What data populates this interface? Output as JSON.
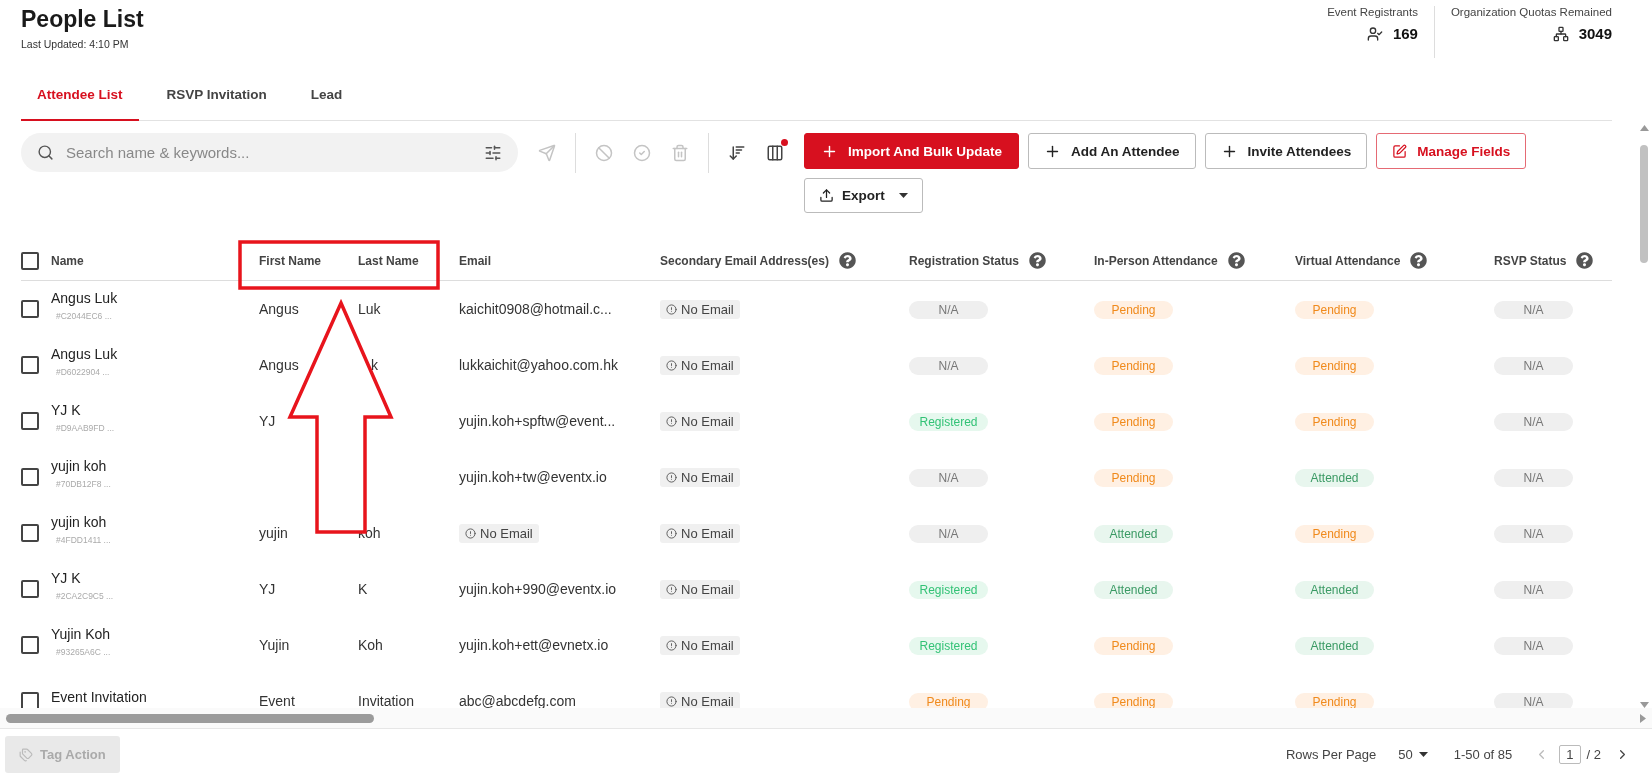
{
  "page": {
    "title": "People List",
    "subtitle": "Last Updated: 4:10 PM"
  },
  "stats": [
    {
      "label": "Event Registrants",
      "value": "169",
      "kind": "registrants"
    },
    {
      "label": "Organization Quotas Remained",
      "value": "3049",
      "kind": "quota"
    }
  ],
  "tabs": [
    {
      "label": "Attendee List",
      "selected": true
    },
    {
      "label": "RSVP Invitation",
      "selected": false
    },
    {
      "label": "Lead",
      "selected": false
    }
  ],
  "search": {
    "placeholder": "Search name & keywords..."
  },
  "toolbar": {
    "column_alert": true,
    "actions_disabled": true
  },
  "buttons": [
    {
      "label": "Import And Bulk Update",
      "kind": "primary"
    },
    {
      "label": "Add An Attendee",
      "kind": "add"
    },
    {
      "label": "Invite Attendees",
      "kind": "add"
    },
    {
      "label": "Manage Fields",
      "kind": "danger"
    },
    {
      "label": "Export",
      "kind": "export"
    }
  ],
  "table": {
    "select_all": false,
    "columns": [
      {
        "label": "Name",
        "help": false
      },
      {
        "label": "First Name",
        "help": false
      },
      {
        "label": "Last Name",
        "help": false
      },
      {
        "label": "Email",
        "help": false
      },
      {
        "label": "Secondary Email Address(es)",
        "help": true
      },
      {
        "label": "Registration Status",
        "help": true
      },
      {
        "label": "In-Person Attendance",
        "help": true
      },
      {
        "label": "Virtual Attendance",
        "help": true
      },
      {
        "label": "RSVP Status",
        "help": true
      }
    ],
    "rows": [
      {
        "checked": false,
        "name": "Angus Luk",
        "id": "#C2044EC6 ...",
        "first_name": "Angus",
        "last_name": "Luk",
        "email": {
          "kind": "text",
          "text": "kaichit0908@hotmail.c..."
        },
        "secondary": "No Email",
        "statuses": [
          {
            "kind": "na",
            "text": "N/A"
          },
          {
            "kind": "pending",
            "text": "Pending"
          },
          {
            "kind": "pending",
            "text": "Pending"
          },
          {
            "kind": "na",
            "text": "N/A"
          }
        ]
      },
      {
        "checked": false,
        "name": "Angus Luk",
        "id": "#D6022904 ...",
        "first_name": "Angus",
        "last_name": "k",
        "last_name_partly_covered": true,
        "email": {
          "kind": "text",
          "text": "lukkaichit@yahoo.com.hk"
        },
        "secondary": "No Email",
        "statuses": [
          {
            "kind": "na",
            "text": "N/A"
          },
          {
            "kind": "pending",
            "text": "Pending"
          },
          {
            "kind": "pending",
            "text": "Pending"
          },
          {
            "kind": "na",
            "text": "N/A"
          }
        ]
      },
      {
        "checked": false,
        "name": "YJ K",
        "id": "#D9AAB9FD ...",
        "first_name": "YJ",
        "email": {
          "kind": "text",
          "text": "yujin.koh+spftw@event..."
        },
        "secondary": "No Email",
        "statuses": [
          {
            "kind": "registered",
            "text": "Registered"
          },
          {
            "kind": "pending",
            "text": "Pending"
          },
          {
            "kind": "pending",
            "text": "Pending"
          },
          {
            "kind": "na",
            "text": "N/A"
          }
        ]
      },
      {
        "checked": false,
        "name": "yujin koh",
        "id": "#70DB12F8 ...",
        "email": {
          "kind": "text",
          "text": "yujin.koh+tw@eventx.io"
        },
        "secondary": "No Email",
        "statuses": [
          {
            "kind": "na",
            "text": "N/A"
          },
          {
            "kind": "pending",
            "text": "Pending"
          },
          {
            "kind": "attended",
            "text": "Attended"
          },
          {
            "kind": "na",
            "text": "N/A"
          }
        ]
      },
      {
        "checked": false,
        "name": "yujin koh",
        "id": "#4FDD1411 ...",
        "first_name": "yujin",
        "last_name": "koh",
        "email": {
          "kind": "badge",
          "text": "No Email"
        },
        "secondary": "No Email",
        "statuses": [
          {
            "kind": "na",
            "text": "N/A"
          },
          {
            "kind": "attended",
            "text": "Attended"
          },
          {
            "kind": "pending",
            "text": "Pending"
          },
          {
            "kind": "na",
            "text": "N/A"
          }
        ]
      },
      {
        "checked": false,
        "name": "YJ K",
        "id": "#2CA2C9C5 ...",
        "first_name": "YJ",
        "last_name": "K",
        "email": {
          "kind": "text",
          "text": "yujin.koh+990@eventx.io"
        },
        "secondary": "No Email",
        "statuses": [
          {
            "kind": "registered",
            "text": "Registered"
          },
          {
            "kind": "attended",
            "text": "Attended"
          },
          {
            "kind": "attended",
            "text": "Attended"
          },
          {
            "kind": "na",
            "text": "N/A"
          }
        ]
      },
      {
        "checked": false,
        "name": "Yujin Koh",
        "id": "#93265A6C ...",
        "first_name": "Yujin",
        "last_name": "Koh",
        "email": {
          "kind": "text",
          "text": "yujin.koh+ett@evnetx.io"
        },
        "secondary": "No Email",
        "statuses": [
          {
            "kind": "registered",
            "text": "Registered"
          },
          {
            "kind": "pending",
            "text": "Pending"
          },
          {
            "kind": "attended",
            "text": "Attended"
          },
          {
            "kind": "na",
            "text": "N/A"
          }
        ]
      },
      {
        "checked": false,
        "name": "Event Invitation",
        "first_name": "Event",
        "last_name": "Invitation",
        "email": {
          "kind": "text",
          "text": "abc@abcdefg.com"
        },
        "secondary": "No Email",
        "statuses": [
          {
            "kind": "pending",
            "text": "Pending"
          },
          {
            "kind": "pending",
            "text": "Pending"
          },
          {
            "kind": "pending",
            "text": "Pending"
          },
          {
            "kind": "na",
            "text": "N/A"
          }
        ]
      }
    ]
  },
  "footer": {
    "tag_action": {
      "label": "Tag Action",
      "disabled": true
    },
    "rows_per_page_label": "Rows Per Page",
    "rows_per_page": "50",
    "range": "1-50 of 85",
    "page": "1",
    "total_pages": "/ 2"
  },
  "annotations": {
    "highlight_box": true,
    "arrow": true
  }
}
